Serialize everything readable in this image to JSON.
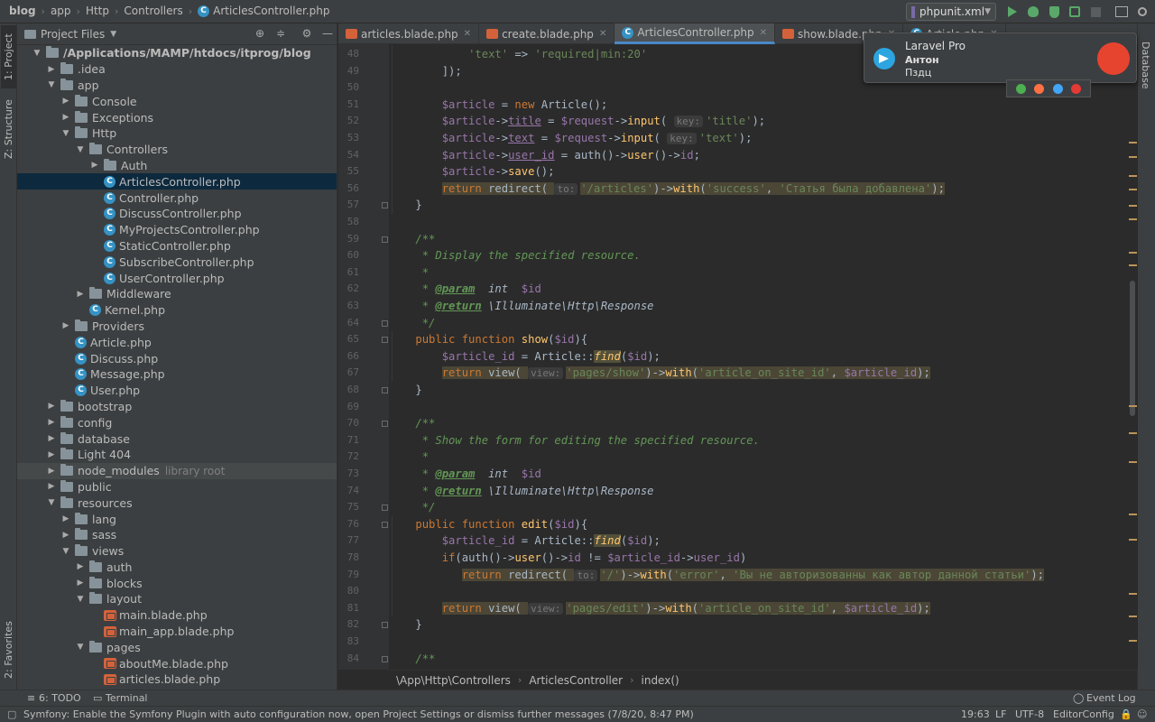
{
  "nav": {
    "crumbs": [
      "blog",
      "app",
      "Http",
      "Controllers",
      "ArticlesController.php"
    ],
    "run_config": "phpunit.xml"
  },
  "left_strip": {
    "project": "1: Project",
    "structure": "Z: Structure",
    "favorites": "2: Favorites"
  },
  "right_strip": {
    "database": "Database"
  },
  "project_panel": {
    "title": "Project Files",
    "tree": [
      {
        "label": "/Applications/MAMP/htdocs/itprog/blog",
        "depth": 0,
        "type": "folder",
        "open": true,
        "bold": true
      },
      {
        "label": ".idea",
        "depth": 1,
        "type": "folder",
        "open": false
      },
      {
        "label": "app",
        "depth": 1,
        "type": "folder",
        "open": true
      },
      {
        "label": "Console",
        "depth": 2,
        "type": "folder",
        "open": false
      },
      {
        "label": "Exceptions",
        "depth": 2,
        "type": "folder",
        "open": false
      },
      {
        "label": "Http",
        "depth": 2,
        "type": "folder",
        "open": true
      },
      {
        "label": "Controllers",
        "depth": 3,
        "type": "folder",
        "open": true
      },
      {
        "label": "Auth",
        "depth": 4,
        "type": "folder",
        "open": false
      },
      {
        "label": "ArticlesController.php",
        "depth": 4,
        "type": "class",
        "selected": true
      },
      {
        "label": "Controller.php",
        "depth": 4,
        "type": "class"
      },
      {
        "label": "DiscussController.php",
        "depth": 4,
        "type": "class"
      },
      {
        "label": "MyProjectsController.php",
        "depth": 4,
        "type": "class"
      },
      {
        "label": "StaticController.php",
        "depth": 4,
        "type": "class"
      },
      {
        "label": "SubscribeController.php",
        "depth": 4,
        "type": "class"
      },
      {
        "label": "UserController.php",
        "depth": 4,
        "type": "class"
      },
      {
        "label": "Middleware",
        "depth": 3,
        "type": "folder",
        "open": false
      },
      {
        "label": "Kernel.php",
        "depth": 3,
        "type": "class"
      },
      {
        "label": "Providers",
        "depth": 2,
        "type": "folder",
        "open": false
      },
      {
        "label": "Article.php",
        "depth": 2,
        "type": "class"
      },
      {
        "label": "Discuss.php",
        "depth": 2,
        "type": "class"
      },
      {
        "label": "Message.php",
        "depth": 2,
        "type": "class"
      },
      {
        "label": "User.php",
        "depth": 2,
        "type": "class"
      },
      {
        "label": "bootstrap",
        "depth": 1,
        "type": "folder",
        "open": false
      },
      {
        "label": "config",
        "depth": 1,
        "type": "folder",
        "open": false
      },
      {
        "label": "database",
        "depth": 1,
        "type": "folder",
        "open": false
      },
      {
        "label": "Light 404",
        "depth": 1,
        "type": "folder",
        "open": false
      },
      {
        "label": "node_modules",
        "depth": 1,
        "type": "folder",
        "open": false,
        "extra": "library root",
        "dim": true
      },
      {
        "label": "public",
        "depth": 1,
        "type": "folder",
        "open": false
      },
      {
        "label": "resources",
        "depth": 1,
        "type": "folder",
        "open": true
      },
      {
        "label": "lang",
        "depth": 2,
        "type": "folder",
        "open": false
      },
      {
        "label": "sass",
        "depth": 2,
        "type": "folder",
        "open": false
      },
      {
        "label": "views",
        "depth": 2,
        "type": "folder",
        "open": true
      },
      {
        "label": "auth",
        "depth": 3,
        "type": "folder",
        "open": false
      },
      {
        "label": "blocks",
        "depth": 3,
        "type": "folder",
        "open": false
      },
      {
        "label": "layout",
        "depth": 3,
        "type": "folder",
        "open": true
      },
      {
        "label": "main.blade.php",
        "depth": 4,
        "type": "blade"
      },
      {
        "label": "main_app.blade.php",
        "depth": 4,
        "type": "blade"
      },
      {
        "label": "pages",
        "depth": 3,
        "type": "folder",
        "open": true
      },
      {
        "label": "aboutMe.blade.php",
        "depth": 4,
        "type": "blade"
      },
      {
        "label": "articles.blade.php",
        "depth": 4,
        "type": "blade"
      }
    ]
  },
  "tabs": [
    {
      "label": "articles.blade.php",
      "kind": "blade",
      "active": false
    },
    {
      "label": "create.blade.php",
      "kind": "blade",
      "active": false
    },
    {
      "label": "ArticlesController.php",
      "kind": "class",
      "active": true
    },
    {
      "label": "show.blade.php",
      "kind": "blade",
      "active": false
    },
    {
      "label": "Article.php",
      "kind": "class",
      "active": false
    }
  ],
  "editor": {
    "line_numbers": [
      "48",
      "49",
      "50",
      "51",
      "52",
      "53",
      "54",
      "55",
      "56",
      "57",
      "58",
      "59",
      "60",
      "61",
      "62",
      "63",
      "64",
      "65",
      "66",
      "67",
      "68",
      "69",
      "70",
      "71",
      "72",
      "73",
      "74",
      "75",
      "76",
      "77",
      "78",
      "79",
      "80",
      "81",
      "82",
      "83",
      "84"
    ],
    "lines": [
      [
        {
          "t": "            ",
          "c": ""
        },
        {
          "t": "'text'",
          "c": "s"
        },
        {
          "t": " => ",
          "c": ""
        },
        {
          "t": "'required|min:20'",
          "c": "s"
        }
      ],
      [
        {
          "t": "        ]);",
          "c": ""
        }
      ],
      [],
      [
        {
          "t": "        ",
          "c": ""
        },
        {
          "t": "$article",
          "c": "v"
        },
        {
          "t": " = ",
          "c": ""
        },
        {
          "t": "new ",
          "c": "kw"
        },
        {
          "t": "Article();",
          "c": ""
        }
      ],
      [
        {
          "t": "        ",
          "c": ""
        },
        {
          "t": "$article",
          "c": "v"
        },
        {
          "t": "->",
          "c": ""
        },
        {
          "t": "title",
          "c": "m"
        },
        {
          "t": " = ",
          "c": ""
        },
        {
          "t": "$request",
          "c": "v"
        },
        {
          "t": "->",
          "c": ""
        },
        {
          "t": "input",
          "c": "f"
        },
        {
          "t": "( ",
          "c": ""
        },
        {
          "t": "key:",
          "c": "hint"
        },
        {
          "t": "'title'",
          "c": "s"
        },
        {
          "t": ");",
          "c": ""
        }
      ],
      [
        {
          "t": "        ",
          "c": ""
        },
        {
          "t": "$article",
          "c": "v"
        },
        {
          "t": "->",
          "c": ""
        },
        {
          "t": "text",
          "c": "m"
        },
        {
          "t": " = ",
          "c": ""
        },
        {
          "t": "$request",
          "c": "v"
        },
        {
          "t": "->",
          "c": ""
        },
        {
          "t": "input",
          "c": "f"
        },
        {
          "t": "( ",
          "c": ""
        },
        {
          "t": "key:",
          "c": "hint"
        },
        {
          "t": "'text'",
          "c": "s"
        },
        {
          "t": ");",
          "c": ""
        }
      ],
      [
        {
          "t": "        ",
          "c": ""
        },
        {
          "t": "$article",
          "c": "v"
        },
        {
          "t": "->",
          "c": ""
        },
        {
          "t": "user_id",
          "c": "m"
        },
        {
          "t": " = auth()->",
          "c": ""
        },
        {
          "t": "user",
          "c": "f"
        },
        {
          "t": "()->",
          "c": ""
        },
        {
          "t": "id",
          "c": "v"
        },
        {
          "t": ";",
          "c": ""
        }
      ],
      [
        {
          "t": "        ",
          "c": ""
        },
        {
          "t": "$article",
          "c": "v"
        },
        {
          "t": "->",
          "c": ""
        },
        {
          "t": "save",
          "c": "f"
        },
        {
          "t": "();",
          "c": ""
        }
      ],
      [
        {
          "t": "        ",
          "c": ""
        },
        {
          "t": "return ",
          "c": "kw hl"
        },
        {
          "t": "redirect( ",
          "c": "hl"
        },
        {
          "t": "to:",
          "c": "hint"
        },
        {
          "t": "'/articles'",
          "c": "s hl"
        },
        {
          "t": ")->",
          "c": "hl"
        },
        {
          "t": "with",
          "c": "f hl"
        },
        {
          "t": "(",
          "c": "hl"
        },
        {
          "t": "'success'",
          "c": "s hl"
        },
        {
          "t": ", ",
          "c": "hl"
        },
        {
          "t": "'Статья была добавлена'",
          "c": "s hl"
        },
        {
          "t": ");",
          "c": "hl"
        }
      ],
      [
        {
          "t": "    }",
          "c": ""
        }
      ],
      [],
      [
        {
          "t": "    ",
          "c": ""
        },
        {
          "t": "/**",
          "c": "cm"
        }
      ],
      [
        {
          "t": "     ",
          "c": ""
        },
        {
          "t": "* Display the specified resource.",
          "c": "cm"
        }
      ],
      [
        {
          "t": "     ",
          "c": ""
        },
        {
          "t": "*",
          "c": "cm"
        }
      ],
      [
        {
          "t": "     ",
          "c": ""
        },
        {
          "t": "* ",
          "c": "cm"
        },
        {
          "t": "@param",
          "c": "tag"
        },
        {
          "t": "  int  ",
          "c": "ty"
        },
        {
          "t": "$id",
          "c": "v cmv"
        }
      ],
      [
        {
          "t": "     ",
          "c": ""
        },
        {
          "t": "* ",
          "c": "cm"
        },
        {
          "t": "@return",
          "c": "tag"
        },
        {
          "t": " \\Illuminate\\Http\\Response",
          "c": "ty"
        }
      ],
      [
        {
          "t": "     ",
          "c": ""
        },
        {
          "t": "*/",
          "c": "cm"
        }
      ],
      [
        {
          "t": "    ",
          "c": ""
        },
        {
          "t": "public function ",
          "c": "kw"
        },
        {
          "t": "show",
          "c": "f"
        },
        {
          "t": "(",
          "c": ""
        },
        {
          "t": "$id",
          "c": "v"
        },
        {
          "t": "){",
          "c": ""
        }
      ],
      [
        {
          "t": "        ",
          "c": ""
        },
        {
          "t": "$article_id",
          "c": "v"
        },
        {
          "t": " = Article::",
          "c": ""
        },
        {
          "t": "find",
          "c": "sf"
        },
        {
          "t": "(",
          "c": ""
        },
        {
          "t": "$id",
          "c": "v"
        },
        {
          "t": ");",
          "c": ""
        }
      ],
      [
        {
          "t": "        ",
          "c": ""
        },
        {
          "t": "return ",
          "c": "kw hl"
        },
        {
          "t": "view( ",
          "c": "hl"
        },
        {
          "t": "view:",
          "c": "hint"
        },
        {
          "t": "'pages/show'",
          "c": "s hl"
        },
        {
          "t": ")->",
          "c": "hl"
        },
        {
          "t": "with",
          "c": "f hl"
        },
        {
          "t": "(",
          "c": "hl"
        },
        {
          "t": "'article_on_site_id'",
          "c": "s hl"
        },
        {
          "t": ", ",
          "c": "hl"
        },
        {
          "t": "$article_id",
          "c": "v hl"
        },
        {
          "t": ");",
          "c": "hl"
        }
      ],
      [
        {
          "t": "    }",
          "c": ""
        }
      ],
      [],
      [
        {
          "t": "    ",
          "c": ""
        },
        {
          "t": "/**",
          "c": "cm"
        }
      ],
      [
        {
          "t": "     ",
          "c": ""
        },
        {
          "t": "* Show the form for editing the specified resource.",
          "c": "cm"
        }
      ],
      [
        {
          "t": "     ",
          "c": ""
        },
        {
          "t": "*",
          "c": "cm"
        }
      ],
      [
        {
          "t": "     ",
          "c": ""
        },
        {
          "t": "* ",
          "c": "cm"
        },
        {
          "t": "@param",
          "c": "tag"
        },
        {
          "t": "  int  ",
          "c": "ty"
        },
        {
          "t": "$id",
          "c": "v cmv"
        }
      ],
      [
        {
          "t": "     ",
          "c": ""
        },
        {
          "t": "* ",
          "c": "cm"
        },
        {
          "t": "@return",
          "c": "tag"
        },
        {
          "t": " \\Illuminate\\Http\\Response",
          "c": "ty"
        }
      ],
      [
        {
          "t": "     ",
          "c": ""
        },
        {
          "t": "*/",
          "c": "cm"
        }
      ],
      [
        {
          "t": "    ",
          "c": ""
        },
        {
          "t": "public function ",
          "c": "kw"
        },
        {
          "t": "edit",
          "c": "f"
        },
        {
          "t": "(",
          "c": ""
        },
        {
          "t": "$id",
          "c": "v"
        },
        {
          "t": "){",
          "c": ""
        }
      ],
      [
        {
          "t": "        ",
          "c": ""
        },
        {
          "t": "$article_id",
          "c": "v"
        },
        {
          "t": " = Article::",
          "c": ""
        },
        {
          "t": "find",
          "c": "sf"
        },
        {
          "t": "(",
          "c": ""
        },
        {
          "t": "$id",
          "c": "v"
        },
        {
          "t": ");",
          "c": ""
        }
      ],
      [
        {
          "t": "        ",
          "c": ""
        },
        {
          "t": "if",
          "c": "kw"
        },
        {
          "t": "(auth()->",
          "c": ""
        },
        {
          "t": "user",
          "c": "f"
        },
        {
          "t": "()->",
          "c": ""
        },
        {
          "t": "id",
          "c": "v"
        },
        {
          "t": " != ",
          "c": ""
        },
        {
          "t": "$article_id",
          "c": "v"
        },
        {
          "t": "->",
          "c": ""
        },
        {
          "t": "user_id",
          "c": "v"
        },
        {
          "t": ")",
          "c": ""
        }
      ],
      [
        {
          "t": "           ",
          "c": ""
        },
        {
          "t": "return ",
          "c": "kw hl"
        },
        {
          "t": "redirect( ",
          "c": "hl"
        },
        {
          "t": "to:",
          "c": "hint"
        },
        {
          "t": "'/'",
          "c": "s hl"
        },
        {
          "t": ")->",
          "c": "hl"
        },
        {
          "t": "with",
          "c": "f hl"
        },
        {
          "t": "(",
          "c": "hl"
        },
        {
          "t": "'error'",
          "c": "s hl"
        },
        {
          "t": ", ",
          "c": "hl"
        },
        {
          "t": "'Вы не авторизованны как автор данной статьи'",
          "c": "s hl"
        },
        {
          "t": ");",
          "c": "hl"
        }
      ],
      [],
      [
        {
          "t": "        ",
          "c": ""
        },
        {
          "t": "return ",
          "c": "kw hl"
        },
        {
          "t": "view( ",
          "c": "hl"
        },
        {
          "t": "view:",
          "c": "hint"
        },
        {
          "t": "'pages/edit'",
          "c": "s hl"
        },
        {
          "t": ")->",
          "c": "hl"
        },
        {
          "t": "with",
          "c": "f hl"
        },
        {
          "t": "(",
          "c": "hl"
        },
        {
          "t": "'article_on_site_id'",
          "c": "s hl"
        },
        {
          "t": ", ",
          "c": "hl"
        },
        {
          "t": "$article_id",
          "c": "v hl"
        },
        {
          "t": ");",
          "c": "hl"
        }
      ],
      [
        {
          "t": "    }",
          "c": ""
        }
      ],
      [],
      [
        {
          "t": "    ",
          "c": ""
        },
        {
          "t": "/**",
          "c": "cm"
        }
      ]
    ]
  },
  "editor_breadcrumb": [
    "\\App\\Http\\Controllers",
    "ArticlesController",
    "index()"
  ],
  "notification": {
    "app": "Laravel Pro",
    "sender": "Антон",
    "message": "Пздц"
  },
  "bottom_tabs": {
    "todo": "6: TODO",
    "terminal": "Terminal",
    "event_log": "Event Log"
  },
  "status": {
    "message": "Symfony: Enable the Symfony Plugin with auto configuration now, open Project Settings or dismiss further messages (7/8/20, 8:47 PM)",
    "position": "19:63",
    "line_sep": "LF",
    "encoding": "UTF-8",
    "config": "EditorConfig"
  },
  "colors": {
    "accent": "#4a88c7",
    "selection": "#0d293e",
    "brand_laravel": "#e74430",
    "telegram": "#2ca5e0"
  }
}
